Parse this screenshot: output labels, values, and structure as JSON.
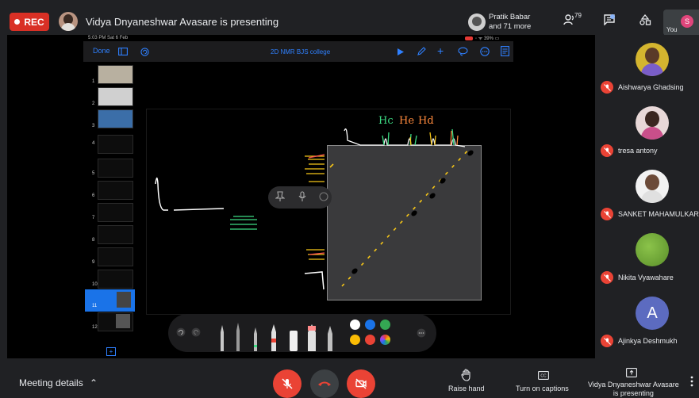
{
  "topbar": {
    "rec_label": "REC",
    "presenting_title": "Vidya Dnyaneshwar Avasare is presenting",
    "others_line1": "Pratik Babar",
    "others_line2": "and 71 more",
    "people_count": "79",
    "you_label": "You",
    "self_initial": "S"
  },
  "tablet": {
    "status_time": "5:03 PM  Sat 6 Feb",
    "status_battery": "39%",
    "done_label": "Done",
    "doc_title": "2D NMR BJS college"
  },
  "slides": {
    "numbers": [
      "1",
      "2",
      "3",
      "4",
      "5",
      "6",
      "7",
      "8",
      "9",
      "10",
      "11",
      "12"
    ],
    "active": "11"
  },
  "whiteboard": {
    "labels": [
      "Hc",
      "He",
      "Hd"
    ]
  },
  "participants": [
    {
      "name": "Aishwarya Ghadsing",
      "avatar": "photo"
    },
    {
      "name": "tresa antony",
      "avatar": "photo"
    },
    {
      "name": "SANKET MAHAMULKAR",
      "avatar": "photo"
    },
    {
      "name": "Nikita Vyawahare",
      "avatar": "green-circle"
    },
    {
      "name": "Ajinkya Deshmukh",
      "avatar": "A"
    }
  ],
  "bottombar": {
    "meeting_details": "Meeting details",
    "raise_hand": "Raise hand",
    "captions": "Turn on captions",
    "presenting_line1": "Vidya Dnyaneshwar Avasare",
    "presenting_line2": "is presenting"
  },
  "colors": {
    "rec": "#d93025",
    "accent_blue": "#2f80ff",
    "danger": "#ea4335",
    "panel": "#202124"
  }
}
